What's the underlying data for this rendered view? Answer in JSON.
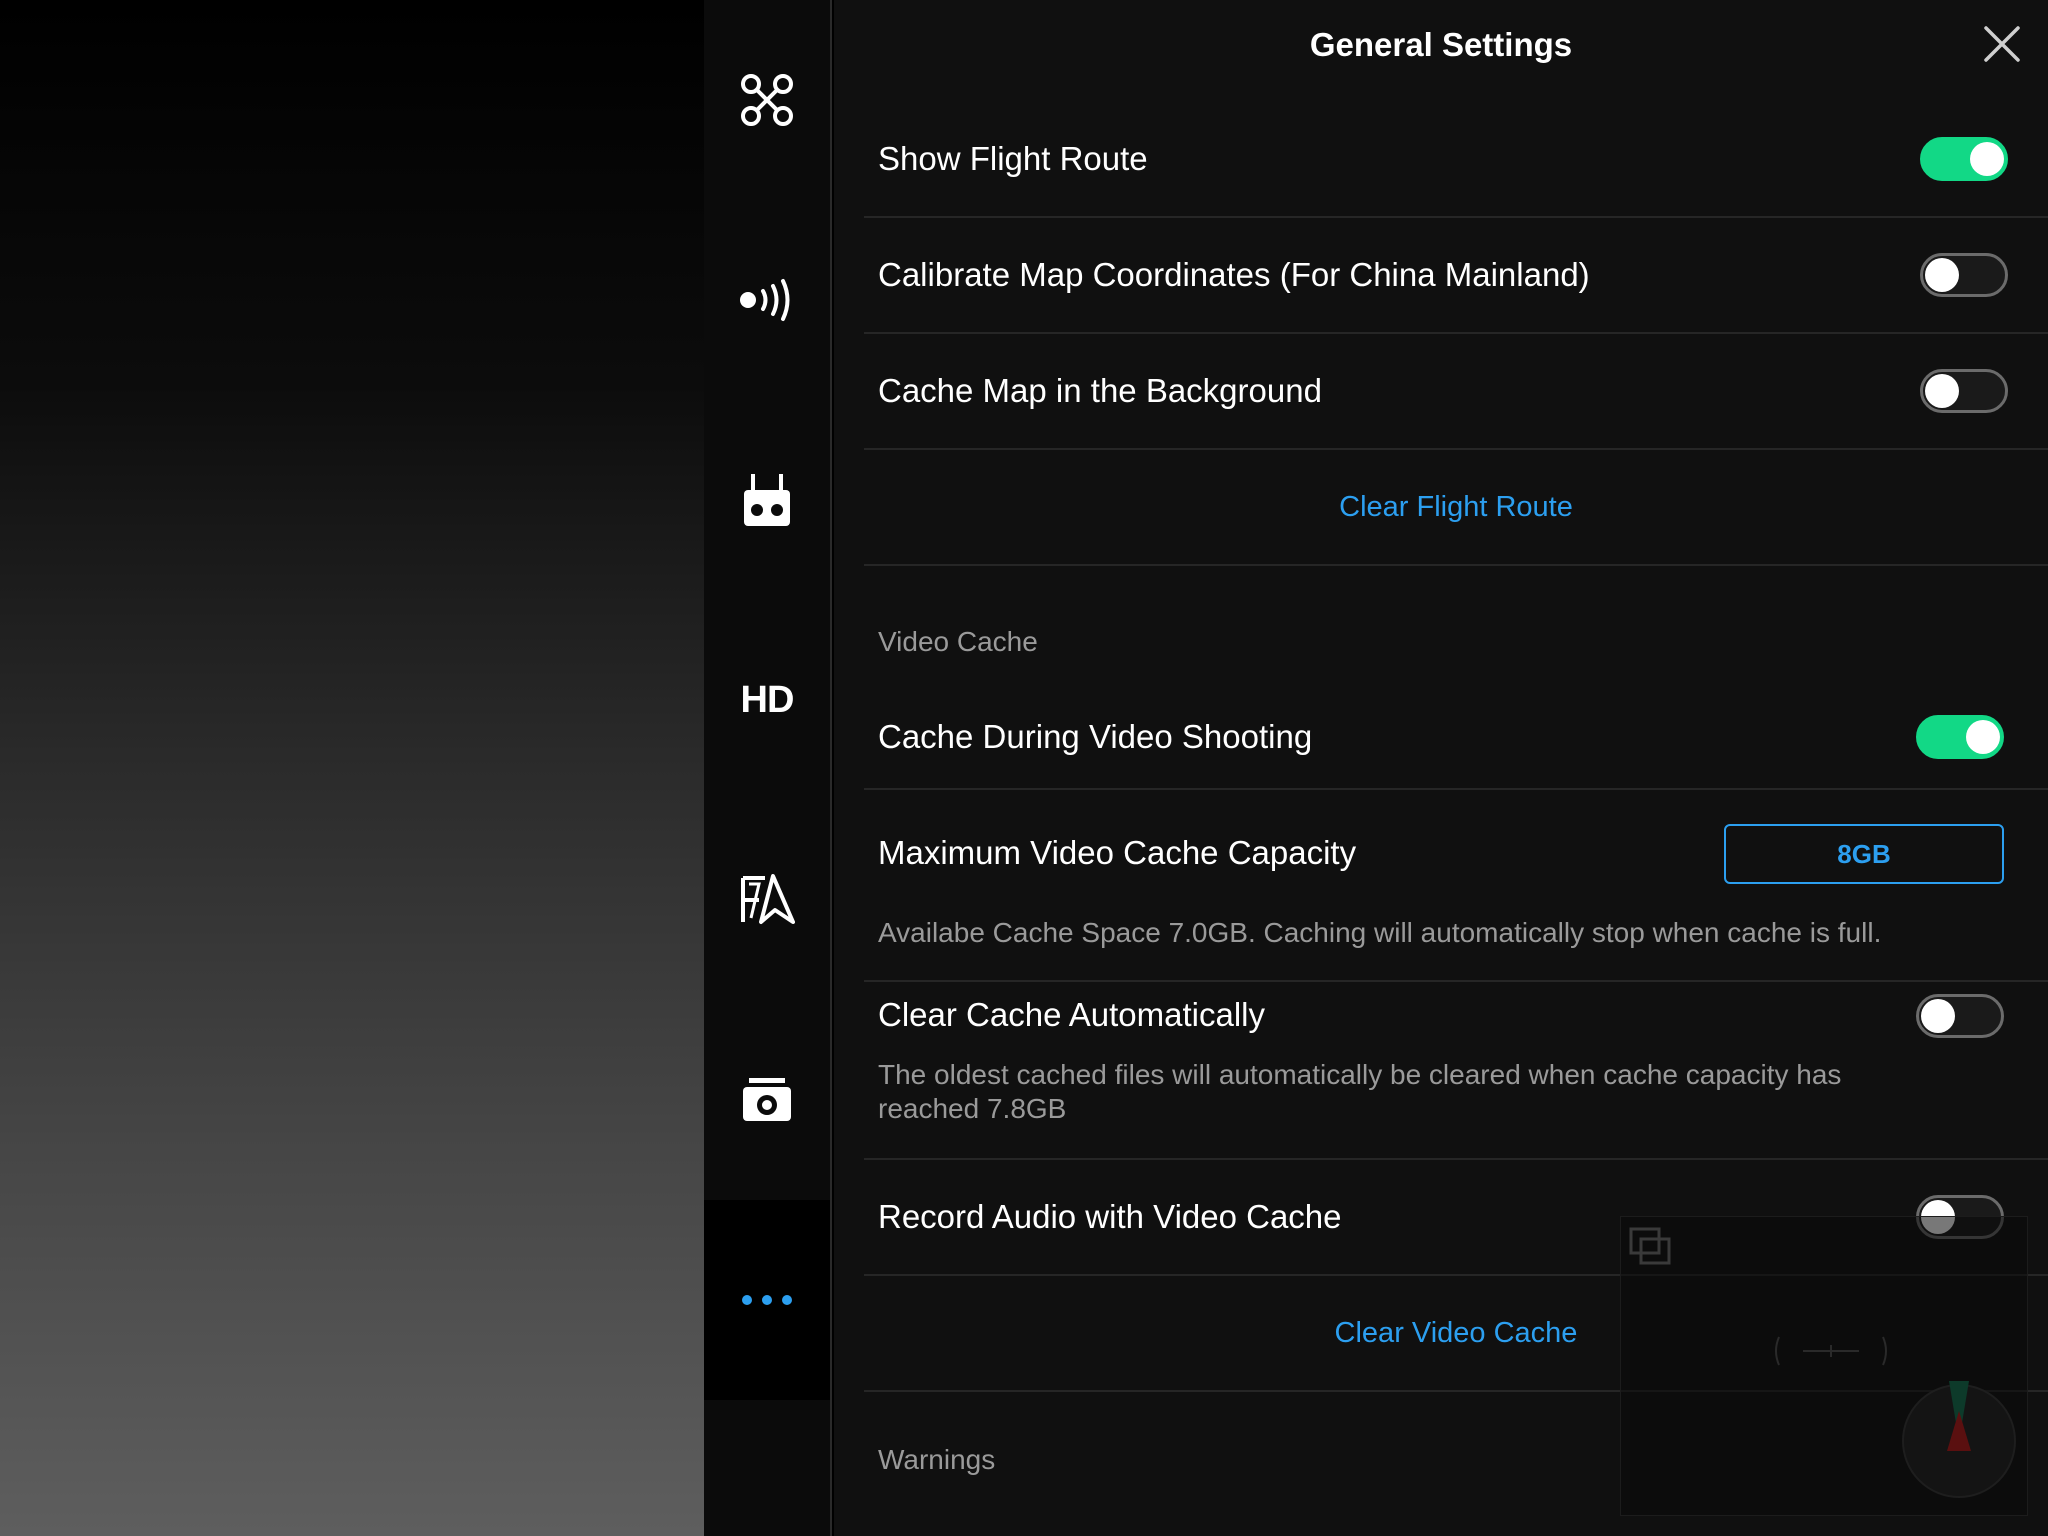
{
  "header": {
    "title": "General Settings"
  },
  "tabs": [
    {
      "id": "aircraft",
      "icon": "drone-icon"
    },
    {
      "id": "signal",
      "icon": "signal-icon"
    },
    {
      "id": "remote",
      "icon": "remote-controller-icon"
    },
    {
      "id": "hd",
      "label": "HD"
    },
    {
      "id": "battery",
      "icon": "battery-icon"
    },
    {
      "id": "camera",
      "icon": "camera-icon"
    },
    {
      "id": "more",
      "icon": "more-icon",
      "active": true
    }
  ],
  "settings": {
    "show_flight_route": {
      "label": "Show Flight Route",
      "on": true
    },
    "calibrate_map": {
      "label": "Calibrate Map Coordinates (For China Mainland)",
      "on": false
    },
    "cache_map": {
      "label": "Cache Map in the Background",
      "on": false
    },
    "clear_flight_route": "Clear Flight Route",
    "video_cache_header": "Video Cache",
    "cache_during_shooting": {
      "label": "Cache During Video Shooting",
      "on": true
    },
    "max_cache": {
      "label": "Maximum Video Cache Capacity",
      "value": "8GB",
      "description": "Availabe Cache Space 7.0GB. Caching will automatically stop when cache is full."
    },
    "clear_cache_auto": {
      "label": "Clear Cache Automatically",
      "on": false,
      "description": "The oldest cached files will automatically be cleared when cache capacity has reached 7.8GB"
    },
    "record_audio": {
      "label": "Record Audio with Video Cache",
      "on": false
    },
    "clear_video_cache": "Clear Video Cache",
    "warnings_header": "Warnings"
  },
  "colors": {
    "accent": "#2c9ff0",
    "toggle_on": "#12d886"
  }
}
